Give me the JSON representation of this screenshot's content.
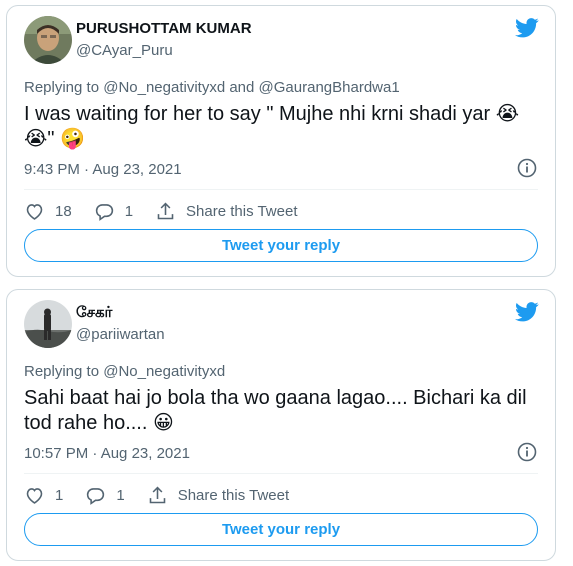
{
  "colors": {
    "accent": "#1d9bf0",
    "secondary": "#536471",
    "text": "#0f1419",
    "border": "#cfd9de"
  },
  "tweets": [
    {
      "name": "PURUSHOTTAM KUMAR",
      "handle": "@CAyar_Puru",
      "replying_prefix": "Replying to ",
      "replying_to": "@No_negativityxd and @GaurangBhardwa1",
      "text": "I was waiting for her to say \" Mujhe nhi krni shadi yar 😭 😭\" 🤪",
      "time": "9:43 PM · Aug 23, 2021",
      "likes": "18",
      "replies": "1",
      "share_label": "Share this Tweet",
      "reply_button": "Tweet your reply",
      "icons": [
        "twitter-bird-icon",
        "info-icon",
        "heart-icon",
        "reply-icon",
        "share-icon"
      ]
    },
    {
      "name": "சேகர்",
      "handle": "@pariiwartan",
      "replying_prefix": "Replying to ",
      "replying_to": "@No_negativityxd",
      "text": "Sahi baat hai jo bola tha wo gaana lagao.... Bichari ka dil tod rahe ho.... 😀",
      "time": "10:57 PM · Aug 23, 2021",
      "likes": "1",
      "replies": "1",
      "share_label": "Share this Tweet",
      "reply_button": "Tweet your reply",
      "icons": [
        "twitter-bird-icon",
        "info-icon",
        "heart-icon",
        "reply-icon",
        "share-icon"
      ]
    }
  ]
}
